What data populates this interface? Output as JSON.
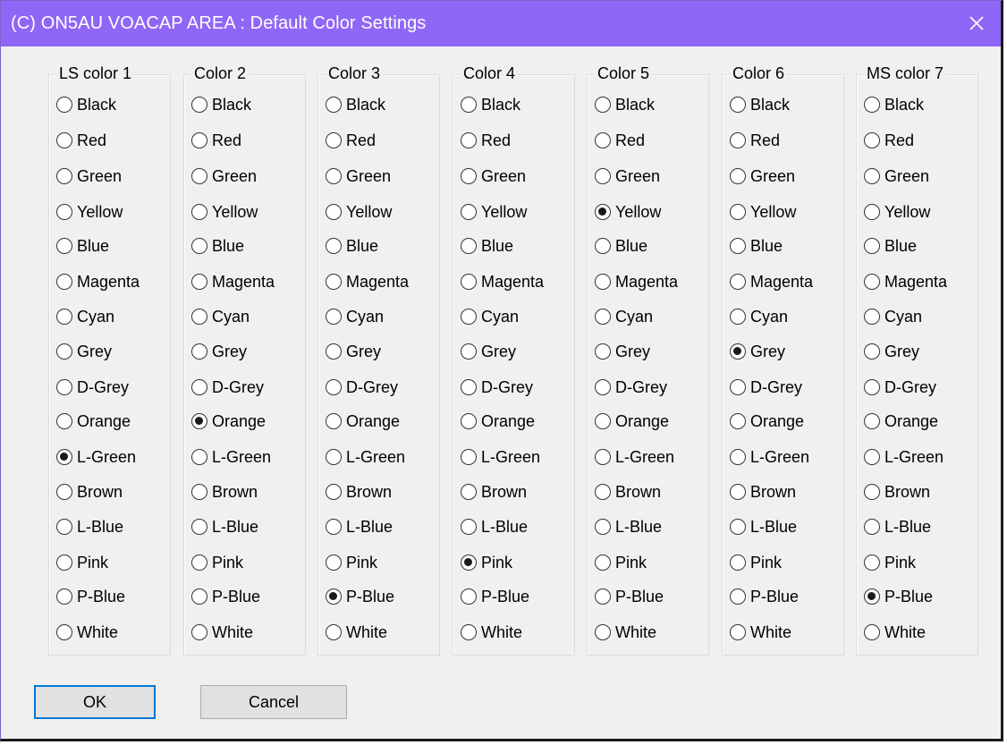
{
  "window": {
    "title": "(C) ON5AU  VOACAP AREA : Default Color Settings",
    "close_icon": "close-icon",
    "titlebar_color": "#8f67f6"
  },
  "color_options": [
    "Black",
    "Red",
    "Green",
    "Yellow",
    "Blue",
    "Magenta",
    "Cyan",
    "Grey",
    "D-Grey",
    "Orange",
    "L-Green",
    "Brown",
    "L-Blue",
    "Pink",
    "P-Blue",
    "White"
  ],
  "groups": [
    {
      "label": "LS color 1",
      "selected": "L-Green"
    },
    {
      "label": "Color 2",
      "selected": "Orange"
    },
    {
      "label": "Color 3",
      "selected": "P-Blue"
    },
    {
      "label": "Color 4",
      "selected": "Pink"
    },
    {
      "label": "Color 5",
      "selected": "Yellow"
    },
    {
      "label": "Color 6",
      "selected": "Grey"
    },
    {
      "label": "MS color 7",
      "selected": "P-Blue"
    }
  ],
  "buttons": {
    "ok": "OK",
    "cancel": "Cancel"
  }
}
